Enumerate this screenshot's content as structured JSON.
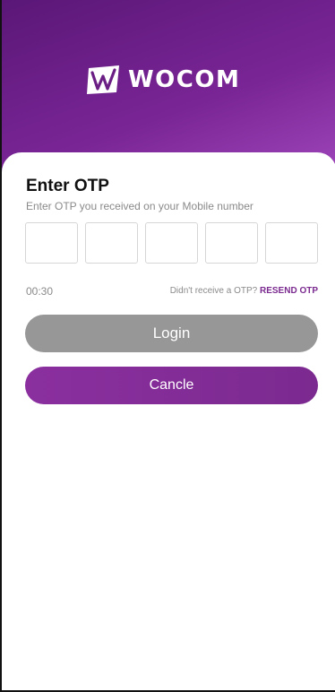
{
  "brand": {
    "name": "WOCOM",
    "header_gradient": [
      "#5a1777",
      "#a44bc0"
    ],
    "accent": "#7b2a90"
  },
  "form": {
    "title": "Enter OTP",
    "subtitle": "Enter OTP you received on your Mobile number",
    "otp_digits": [
      "",
      "",
      "",
      "",
      ""
    ],
    "timer": "00:30",
    "resend_prompt": "Didn't receive a OTP?",
    "resend_link": "RESEND OTP"
  },
  "buttons": {
    "login_label": "Login",
    "login_color": "#979797",
    "cancel_label": "Cancle",
    "cancel_color": "#7b2a90"
  },
  "icons": {
    "logo": "wocom-logo-icon"
  }
}
